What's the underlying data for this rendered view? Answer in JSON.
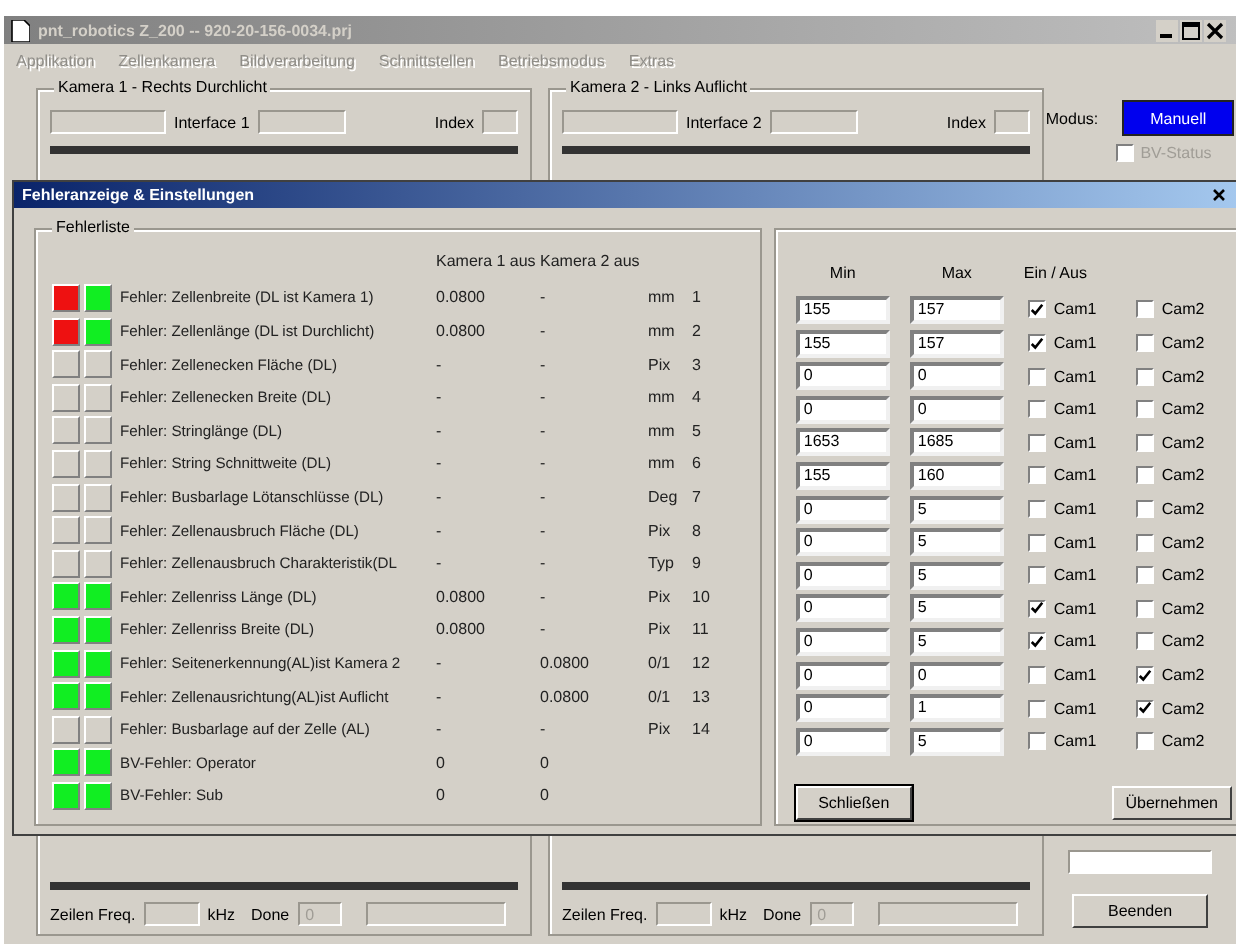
{
  "window": {
    "title": "pnt_robotics Z_200 -- 920-20-156-0034.prj",
    "menu": [
      {
        "label": "Applikation",
        "disabled": true
      },
      {
        "label": "Zellenkamera",
        "disabled": true
      },
      {
        "label": "Bildverarbeitung",
        "disabled": true
      },
      {
        "label": "Schnittstellen",
        "disabled": true
      },
      {
        "label": "Betriebsmodus",
        "disabled": true
      },
      {
        "label": "Extras",
        "disabled": true
      }
    ]
  },
  "cameras": [
    {
      "title": "Kamera 1 - Rechts Durchlicht",
      "interface_label": "Interface 1",
      "index_label": "Index",
      "freq_label": "Zeilen Freq.",
      "freq_unit": "kHz",
      "done_label": "Done",
      "done_value": "0",
      "top_bar": {
        "level": 1
      },
      "bottom_bar": {
        "level": 1
      }
    },
    {
      "title": "Kamera 2 - Links Auflicht",
      "interface_label": "Interface 2",
      "index_label": "Index",
      "freq_label": "Zeilen Freq.",
      "freq_unit": "kHz",
      "done_label": "Done",
      "done_value": "0",
      "top_bar": {
        "level": 1
      },
      "bottom_bar": {
        "level": 1
      }
    }
  ],
  "mode": {
    "label": "Modus:",
    "button": "Manuell",
    "bv_status": {
      "label": "BV-Status",
      "checked": false,
      "disabled": true
    }
  },
  "dialog": {
    "title": "Fehleranzeige & Einstellungen",
    "list_title": "Fehlerliste",
    "columns": [
      "Kamera 1 aus",
      "Kamera 2 aus"
    ],
    "range_columns": [
      "Min",
      "Max"
    ],
    "toggle_column": "Ein / Aus",
    "rows": [
      {
        "lamps": [
          {
            "color": "#ee1111"
          },
          {
            "color": "#11ee22"
          }
        ],
        "label": "Fehler: Zellenbreite (DL ist Kamera 1)",
        "cam1": "0.0800",
        "cam2": "-",
        "unit": "mm",
        "index": "1",
        "min": "155",
        "max": "157",
        "toggles": [
          {
            "label": "Cam1",
            "checked": true
          },
          {
            "label": "Cam2",
            "checked": false
          }
        ]
      },
      {
        "lamps": [
          {
            "color": "#ee1111"
          },
          {
            "color": "#11ee22"
          }
        ],
        "label": "Fehler: Zellenlänge (DL ist Durchlicht)",
        "cam1": "0.0800",
        "cam2": "-",
        "unit": "mm",
        "index": "2",
        "min": "155",
        "max": "157",
        "toggles": [
          {
            "label": "Cam1",
            "checked": true
          },
          {
            "label": "Cam2",
            "checked": false
          }
        ]
      },
      {
        "lamps": [
          {
            "color": "#d4d0c8"
          },
          {
            "color": "#d4d0c8"
          }
        ],
        "label": "Fehler: Zellenecken Fläche (DL)",
        "cam1": "-",
        "cam2": "-",
        "unit": "Pix",
        "index": "3",
        "min": "0",
        "max": "0",
        "toggles": [
          {
            "label": "Cam1",
            "checked": false
          },
          {
            "label": "Cam2",
            "checked": false
          }
        ]
      },
      {
        "lamps": [
          {
            "color": "#d4d0c8"
          },
          {
            "color": "#d4d0c8"
          }
        ],
        "label": "Fehler: Zellenecken Breite (DL)",
        "cam1": "-",
        "cam2": "-",
        "unit": "mm",
        "index": "4",
        "min": "0",
        "max": "0",
        "toggles": [
          {
            "label": "Cam1",
            "checked": false
          },
          {
            "label": "Cam2",
            "checked": false
          }
        ]
      },
      {
        "lamps": [
          {
            "color": "#d4d0c8"
          },
          {
            "color": "#d4d0c8"
          }
        ],
        "label": "Fehler: Stringlänge (DL)",
        "cam1": "-",
        "cam2": "-",
        "unit": "mm",
        "index": "5",
        "min": "1653",
        "max": "1685",
        "toggles": [
          {
            "label": "Cam1",
            "checked": false
          },
          {
            "label": "Cam2",
            "checked": false
          }
        ]
      },
      {
        "lamps": [
          {
            "color": "#d4d0c8"
          },
          {
            "color": "#d4d0c8"
          }
        ],
        "label": "Fehler: String Schnittweite (DL)",
        "cam1": "-",
        "cam2": "-",
        "unit": "mm",
        "index": "6",
        "min": "155",
        "max": "160",
        "toggles": [
          {
            "label": "Cam1",
            "checked": false
          },
          {
            "label": "Cam2",
            "checked": false
          }
        ]
      },
      {
        "lamps": [
          {
            "color": "#d4d0c8"
          },
          {
            "color": "#d4d0c8"
          }
        ],
        "label": "Fehler: Busbarlage Lötanschlüsse (DL)",
        "cam1": "-",
        "cam2": "-",
        "unit": "Deg",
        "index": "7",
        "min": "0",
        "max": "5",
        "toggles": [
          {
            "label": "Cam1",
            "checked": false
          },
          {
            "label": "Cam2",
            "checked": false
          }
        ]
      },
      {
        "lamps": [
          {
            "color": "#d4d0c8"
          },
          {
            "color": "#d4d0c8"
          }
        ],
        "label": "Fehler: Zellenausbruch Fläche (DL)",
        "cam1": "-",
        "cam2": "-",
        "unit": "Pix",
        "index": "8",
        "min": "0",
        "max": "5",
        "toggles": [
          {
            "label": "Cam1",
            "checked": false
          },
          {
            "label": "Cam2",
            "checked": false
          }
        ]
      },
      {
        "lamps": [
          {
            "color": "#d4d0c8"
          },
          {
            "color": "#d4d0c8"
          }
        ],
        "label": "Fehler: Zellenausbruch Charakteristik(DL",
        "cam1": "-",
        "cam2": "-",
        "unit": "Typ",
        "index": "9",
        "min": "0",
        "max": "5",
        "toggles": [
          {
            "label": "Cam1",
            "checked": false
          },
          {
            "label": "Cam2",
            "checked": false
          }
        ]
      },
      {
        "lamps": [
          {
            "color": "#11ee22"
          },
          {
            "color": "#11ee22"
          }
        ],
        "label": "Fehler: Zellenriss Länge (DL)",
        "cam1": "0.0800",
        "cam2": "-",
        "unit": "Pix",
        "index": "10",
        "min": "0",
        "max": "5",
        "toggles": [
          {
            "label": "Cam1",
            "checked": true
          },
          {
            "label": "Cam2",
            "checked": false
          }
        ]
      },
      {
        "lamps": [
          {
            "color": "#11ee22"
          },
          {
            "color": "#11ee22"
          }
        ],
        "label": "Fehler: Zellenriss Breite (DL)",
        "cam1": "0.0800",
        "cam2": "-",
        "unit": "Pix",
        "index": "11",
        "min": "0",
        "max": "5",
        "toggles": [
          {
            "label": "Cam1",
            "checked": true
          },
          {
            "label": "Cam2",
            "checked": false
          }
        ]
      },
      {
        "lamps": [
          {
            "color": "#11ee22"
          },
          {
            "color": "#11ee22"
          }
        ],
        "label": "Fehler: Seitenerkennung(AL)ist Kamera 2",
        "cam1": "-",
        "cam2": "0.0800",
        "unit": "0/1",
        "index": "12",
        "min": "0",
        "max": "0",
        "toggles": [
          {
            "label": "Cam1",
            "checked": false
          },
          {
            "label": "Cam2",
            "checked": true
          }
        ]
      },
      {
        "lamps": [
          {
            "color": "#11ee22"
          },
          {
            "color": "#11ee22"
          }
        ],
        "label": "Fehler: Zellenausrichtung(AL)ist Auflicht",
        "cam1": "-",
        "cam2": "0.0800",
        "unit": "0/1",
        "index": "13",
        "min": "0",
        "max": "1",
        "toggles": [
          {
            "label": "Cam1",
            "checked": false
          },
          {
            "label": "Cam2",
            "checked": true
          }
        ]
      },
      {
        "lamps": [
          {
            "color": "#d4d0c8"
          },
          {
            "color": "#d4d0c8"
          }
        ],
        "label": "Fehler: Busbarlage auf der Zelle (AL)",
        "cam1": "-",
        "cam2": "-",
        "unit": "Pix",
        "index": "14",
        "min": "0",
        "max": "5",
        "toggles": [
          {
            "label": "Cam1",
            "checked": false
          },
          {
            "label": "Cam2",
            "checked": false
          }
        ]
      },
      {
        "lamps": [
          {
            "color": "#11ee22"
          },
          {
            "color": "#11ee22"
          }
        ],
        "label": "BV-Fehler: Operator",
        "cam1": "0",
        "cam2": "0"
      },
      {
        "lamps": [
          {
            "color": "#11ee22"
          },
          {
            "color": "#11ee22"
          }
        ],
        "label": "BV-Fehler: Sub",
        "cam1": "0",
        "cam2": "0"
      }
    ],
    "buttons": [
      "Schließen",
      "Übernehmen"
    ]
  },
  "exit_button": "Beenden"
}
